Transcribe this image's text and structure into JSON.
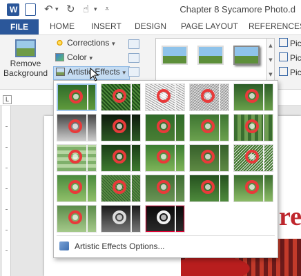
{
  "window": {
    "title": "Chapter 8 Sycamore Photo.d"
  },
  "ribbon_tabs": [
    "FILE",
    "HOME",
    "INSERT",
    "DESIGN",
    "PAGE LAYOUT",
    "REFERENCES"
  ],
  "ribbon": {
    "remove_background": {
      "line1": "Remove",
      "line2": "Background"
    },
    "corrections": "Corrections",
    "color": "Color",
    "artistic_effects": "Artistic Effects",
    "picture_items": [
      "Pic",
      "Pic",
      "Pic"
    ]
  },
  "ruler": {
    "tab_stop_symbol": "L"
  },
  "document": {
    "visible_heading_fragment": "re"
  },
  "gallery": {
    "rows": 5,
    "cols": 5,
    "item_count": 23,
    "selected_index": 0
  },
  "dropdown": {
    "options_label": "Artistic Effects Options..."
  },
  "colors": {
    "accent": "#2b579a",
    "selection": "#c5dcf2",
    "heading": "#c0272d"
  }
}
